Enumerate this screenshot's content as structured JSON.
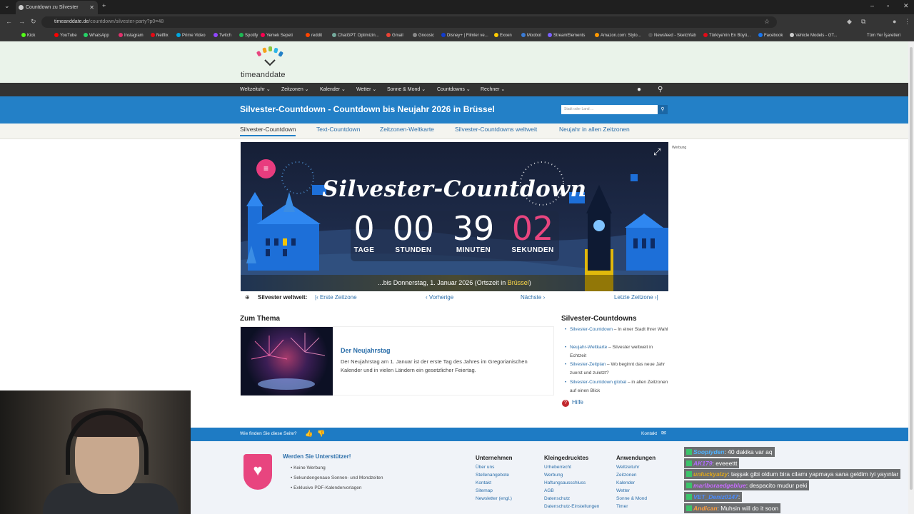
{
  "browser": {
    "tab_title": "Countdown zu Silvester",
    "url_host": "timeanddate.de",
    "url_path": "/countdown/silvester-party?p0=48",
    "bookmarks": [
      "Kick",
      "YouTube",
      "WhatsApp",
      "Instagram",
      "Netflix",
      "Prime Video",
      "Twitch",
      "Spotify",
      "Yemek Sepeti",
      "reddit",
      "ChatGPT: Optimizin...",
      "Gmail",
      "Gnoosic",
      "Disney+ | Filmler ve...",
      "Exxen",
      "Moobot",
      "StreamElements",
      "Amazon.com: Stylo...",
      "Newsfeed - Sketchfab",
      "Türkiye'nin En Büyü...",
      "Facebook",
      "Vehicle Models - GT..."
    ],
    "all_bookmarks": "Tüm Yer İşaretleri"
  },
  "site": {
    "logo": "timeanddate",
    "nav": [
      "Weltzeituhr",
      "Zeitzonen",
      "Kalender",
      "Wetter",
      "Sonne & Mond",
      "Countdowns",
      "Rechner"
    ],
    "title": "Silvester-Countdown - Countdown bis Neujahr 2026 in Brüssel",
    "search_placeholder": "Stadt oder Land ...",
    "subnav": [
      "Silvester-Countdown",
      "Text-Countdown",
      "Zeitzonen-Weltkarte",
      "Silvester-Countdowns weltweit",
      "Neujahr in allen Zeitzonen"
    ],
    "ad_label": "Werbung"
  },
  "countdown": {
    "heading": "Silvester-Countdown",
    "days": "0",
    "days_label": "TAGE",
    "hours": "00",
    "hours_label": "STUNDEN",
    "minutes": "39",
    "minutes_label": "MINUTEN",
    "seconds": "02",
    "seconds_label": "SEKUNDEN",
    "until_prefix": "...bis Donnerstag, 1. Januar 2026 (Ortszeit in ",
    "until_city": "Brüssel",
    "until_suffix": ")"
  },
  "weltweit": {
    "label": "Silvester weltweit:",
    "first": "Erste Zeitzone",
    "prev": "Vorherige",
    "next": "Nächste",
    "last": "Letzte Zeitzone"
  },
  "thema": {
    "heading": "Zum Thema",
    "card_title": "Der Neujahrstag",
    "card_desc": "Der Neujahrstag am 1. Januar ist der erste Tag des Jahres im Gregorianischen Kalender und in vielen Ländern ein gesetzlicher Feiertag."
  },
  "countdowns": {
    "heading": "Silvester-Countdowns",
    "items": [
      {
        "link": "Silvester-Countdown",
        "text": " – In einer Stadt Ihrer Wahl"
      },
      {
        "link": "Neujahr-Weltkarte",
        "text": " – Silvester weltweit in Echtzeit"
      },
      {
        "link": "Silvester-Zeitplan",
        "text": " – Wo beginnt das neue Jahr zuerst und zuletzt?"
      },
      {
        "link": "Silvester-Countdown global",
        "text": " – in allen Zeitzonen auf einen Blick"
      }
    ],
    "help": "Hilfe"
  },
  "feedback": {
    "question": "Wie finden Sie diese Seite?",
    "contact": "Kontakt"
  },
  "footer": {
    "support_title": "Werden Sie Unterstützer!",
    "support_items": [
      "Keine Werbung",
      "Sekundengenaue Sonnen- und Mondzeiten",
      "Exklusive PDF-Kalendervorlagen"
    ],
    "col1_title": "Unternehmen",
    "col1": [
      "Über uns",
      "Stellenangebote",
      "Kontakt",
      "Sitemap",
      "Newsletter (engl.)"
    ],
    "col2_title": "Kleingedrucktes",
    "col2": [
      "Urheberrecht",
      "Werbung",
      "Haftungsausschluss",
      "AGB",
      "Datenschutz",
      "Datenschutz-Einstellungen"
    ],
    "col3_title": "Anwendungen",
    "col3": [
      "Weltzeituhr",
      "Zeitzonen",
      "Kalender",
      "Wetter",
      "Sonne & Mond",
      "Timer"
    ]
  },
  "chat": [
    {
      "user": "Soopiyden",
      "text": ": 40 dakika var aq",
      "color": "#4fb3ff"
    },
    {
      "user": "AK179",
      "text": ": eveeettt",
      "color": "#b06cff"
    },
    {
      "user": "unluckyalzy",
      "text": ": taşşak gibi oldum bira cilamı yapmaya sana geldim iyi yayınlar",
      "color": "#e0a81a"
    },
    {
      "user": "marlboraedgeblue",
      "text": ": despacito mudur peki",
      "color": "#c86bff"
    },
    {
      "user": "VET_Deniz0147",
      "text": ":",
      "color": "#4a8cff"
    },
    {
      "user": "Andican",
      "text": ": Muhsin will do it soon",
      "color": "#ff9c3a"
    }
  ],
  "colors": {
    "accent": "#2380c7",
    "seconds": "#e8457f",
    "nav": "#333333"
  }
}
